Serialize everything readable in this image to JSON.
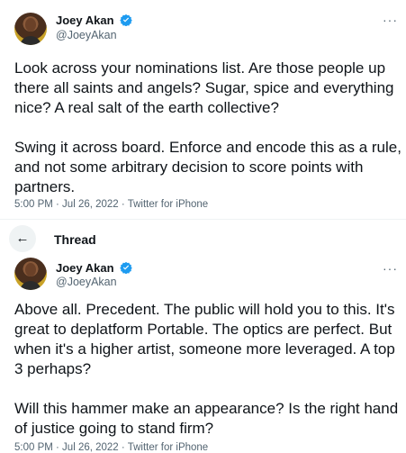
{
  "tweet1": {
    "display_name": "Joey Akan",
    "handle": "@JoeyAkan",
    "text": "Look across your nominations list. Are those people up there all saints and angels? Sugar, spice and everything nice? A real salt of the earth collective?\n\nSwing it across board. Enforce and encode this as a rule, and not some arbitrary decision to score points with partners.",
    "meta": "5:00 PM · Jul 26, 2022 · Twitter for iPhone"
  },
  "thread_header": {
    "title": "Thread",
    "back_icon": "arrow-left-icon"
  },
  "tweet2": {
    "display_name": "Joey Akan",
    "handle": "@JoeyAkan",
    "text": "Above all. Precedent. The public will hold you to this. It's great to deplatform Portable. The optics are perfect. But when it's a higher artist, someone more leveraged. A top 3 perhaps?\n\nWill this hammer make an appearance? Is the right hand of justice going to stand firm?",
    "meta": "5:00 PM · Jul 26, 2022 · Twitter for iPhone"
  },
  "more_icon": "···",
  "colors": {
    "verified": "#1d9bf0",
    "text": "#0f1419",
    "muted": "#536471"
  }
}
